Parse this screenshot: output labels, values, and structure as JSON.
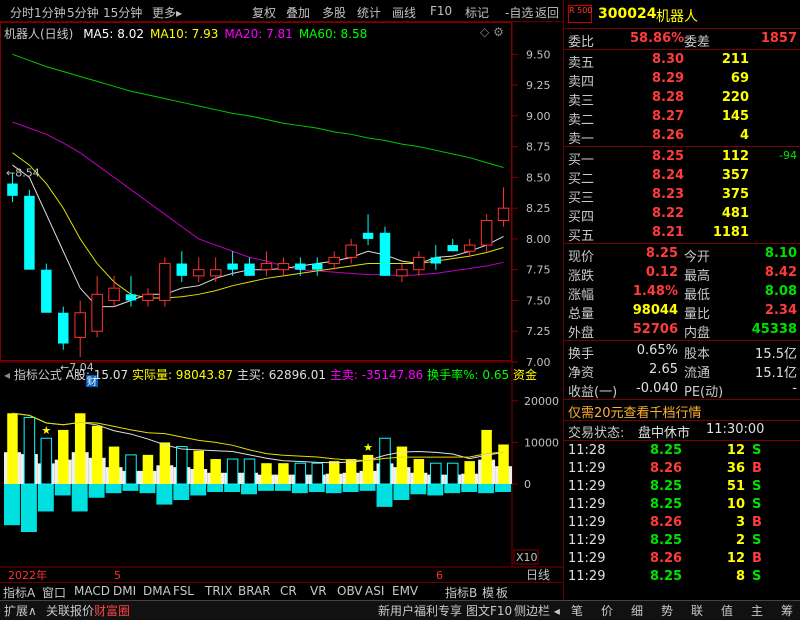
{
  "toolbar": {
    "items": [
      "分时",
      "1分钟",
      "5分钟",
      "15分钟",
      "更多▸",
      "复权",
      "叠加",
      "多股",
      "统计",
      "画线",
      "F10",
      "标记",
      "-自选",
      "返回"
    ]
  },
  "chart": {
    "title": "机器人(日线)",
    "ma_labels": [
      {
        "text": "MA5: 8.02",
        "color": "#ffffff"
      },
      {
        "text": "MA10: 7.93",
        "color": "#ffff00"
      },
      {
        "text": "MA20: 7.81",
        "color": "#ff00ff"
      },
      {
        "text": "MA60: 8.58",
        "color": "#00ff00"
      }
    ],
    "price_axis": [
      "9.50",
      "9.25",
      "9.00",
      "8.75",
      "8.50",
      "8.25",
      "8.00",
      "7.75",
      "7.50",
      "7.25",
      "7.00"
    ],
    "high_mark": "8.54",
    "low_mark": "7.04",
    "cai_mark": "财",
    "indicator_row": {
      "label": "指标公式",
      "a_shares": "A股: 15.07",
      "actual_vol": "实际量: 98043.87",
      "main_buy": "主买: 62896.01",
      "main_sell": "主卖: -35147.86",
      "turnover": "换手率%: 0.65",
      "fund": "资金"
    },
    "vol_axis": [
      "20000",
      "10000",
      "0"
    ],
    "x10": "X10",
    "date_labels": [
      "2022年",
      "5",
      "6"
    ],
    "period": "日线"
  },
  "chart_data": {
    "type": "candlestick",
    "ylim": [
      7.0,
      9.6
    ],
    "candles": [
      {
        "o": 8.45,
        "h": 8.54,
        "l": 8.3,
        "c": 8.35
      },
      {
        "o": 8.35,
        "h": 8.4,
        "l": 7.8,
        "c": 7.75
      },
      {
        "o": 7.75,
        "h": 7.8,
        "l": 7.5,
        "c": 7.4
      },
      {
        "o": 7.4,
        "h": 7.45,
        "l": 7.1,
        "c": 7.15
      },
      {
        "o": 7.2,
        "h": 7.5,
        "l": 7.04,
        "c": 7.4
      },
      {
        "o": 7.25,
        "h": 7.7,
        "l": 7.2,
        "c": 7.55
      },
      {
        "o": 7.5,
        "h": 7.7,
        "l": 7.45,
        "c": 7.6
      },
      {
        "o": 7.55,
        "h": 7.7,
        "l": 7.45,
        "c": 7.5
      },
      {
        "o": 7.5,
        "h": 7.6,
        "l": 7.45,
        "c": 7.55
      },
      {
        "o": 7.5,
        "h": 7.85,
        "l": 7.45,
        "c": 7.8
      },
      {
        "o": 7.8,
        "h": 7.9,
        "l": 7.65,
        "c": 7.7
      },
      {
        "o": 7.7,
        "h": 7.85,
        "l": 7.65,
        "c": 7.75
      },
      {
        "o": 7.7,
        "h": 7.85,
        "l": 7.65,
        "c": 7.75
      },
      {
        "o": 7.8,
        "h": 7.9,
        "l": 7.7,
        "c": 7.75
      },
      {
        "o": 7.8,
        "h": 7.85,
        "l": 7.7,
        "c": 7.7
      },
      {
        "o": 7.75,
        "h": 7.9,
        "l": 7.7,
        "c": 7.8
      },
      {
        "o": 7.75,
        "h": 7.85,
        "l": 7.7,
        "c": 7.8
      },
      {
        "o": 7.8,
        "h": 7.85,
        "l": 7.7,
        "c": 7.75
      },
      {
        "o": 7.8,
        "h": 7.85,
        "l": 7.7,
        "c": 7.75
      },
      {
        "o": 7.8,
        "h": 7.9,
        "l": 7.75,
        "c": 7.85
      },
      {
        "o": 7.85,
        "h": 8.0,
        "l": 7.8,
        "c": 7.95
      },
      {
        "o": 8.05,
        "h": 8.2,
        "l": 7.95,
        "c": 8.0
      },
      {
        "o": 8.05,
        "h": 8.1,
        "l": 7.7,
        "c": 7.7
      },
      {
        "o": 7.7,
        "h": 7.8,
        "l": 7.65,
        "c": 7.75
      },
      {
        "o": 7.75,
        "h": 7.9,
        "l": 7.7,
        "c": 7.85
      },
      {
        "o": 7.85,
        "h": 7.95,
        "l": 7.75,
        "c": 7.8
      },
      {
        "o": 7.95,
        "h": 8.0,
        "l": 7.9,
        "c": 7.9
      },
      {
        "o": 7.9,
        "h": 8.0,
        "l": 7.85,
        "c": 7.95
      },
      {
        "o": 7.95,
        "h": 8.2,
        "l": 7.9,
        "c": 8.15
      },
      {
        "o": 8.15,
        "h": 8.42,
        "l": 8.1,
        "c": 8.25
      }
    ],
    "ma5": [
      8.6,
      8.5,
      8.2,
      7.9,
      7.6,
      7.45,
      7.45,
      7.5,
      7.55,
      7.55,
      7.6,
      7.62,
      7.68,
      7.72,
      7.75,
      7.75,
      7.76,
      7.78,
      7.8,
      7.82,
      7.85,
      7.9,
      7.87,
      7.82,
      7.8,
      7.85,
      7.86,
      7.9,
      7.95,
      8.02
    ],
    "ma10": [
      8.7,
      8.6,
      8.45,
      8.25,
      8.0,
      7.8,
      7.65,
      7.55,
      7.52,
      7.52,
      7.53,
      7.55,
      7.58,
      7.62,
      7.65,
      7.68,
      7.7,
      7.72,
      7.74,
      7.76,
      7.78,
      7.8,
      7.8,
      7.8,
      7.8,
      7.82,
      7.84,
      7.86,
      7.89,
      7.93
    ],
    "ma20": [
      8.95,
      8.9,
      8.85,
      8.78,
      8.7,
      8.6,
      8.5,
      8.4,
      8.3,
      8.2,
      8.1,
      8.0,
      7.95,
      7.9,
      7.85,
      7.82,
      7.78,
      7.75,
      7.74,
      7.73,
      7.72,
      7.71,
      7.71,
      7.7,
      7.71,
      7.72,
      7.74,
      7.76,
      7.78,
      7.81
    ],
    "ma60": [
      9.5,
      9.45,
      9.4,
      9.36,
      9.32,
      9.28,
      9.24,
      9.2,
      9.17,
      9.14,
      9.11,
      9.08,
      9.05,
      9.02,
      9.0,
      8.97,
      8.94,
      8.92,
      8.9,
      8.87,
      8.85,
      8.82,
      8.8,
      8.77,
      8.75,
      8.72,
      8.69,
      8.66,
      8.62,
      8.58
    ],
    "volume_ylim": [
      0,
      25000
    ],
    "volume": [
      17000,
      16000,
      11000,
      13000,
      17000,
      14000,
      9000,
      7000,
      7000,
      10000,
      9000,
      8000,
      6000,
      6000,
      6000,
      5000,
      5000,
      5000,
      5000,
      5500,
      6000,
      7000,
      11000,
      9000,
      6000,
      5000,
      5000,
      5500,
      13000,
      9500
    ],
    "volume_red": [
      true,
      false,
      false,
      true,
      true,
      true,
      true,
      false,
      true,
      true,
      false,
      true,
      true,
      false,
      false,
      true,
      true,
      false,
      false,
      true,
      true,
      true,
      false,
      true,
      true,
      false,
      false,
      true,
      true,
      true
    ],
    "fund_flow": [
      -18000,
      -21000,
      -12000,
      -5000,
      -12000,
      -6000,
      -4000,
      -3000,
      -4000,
      -9000,
      -7000,
      -5000,
      -3500,
      -3500,
      -4500,
      -3000,
      -3000,
      -4000,
      -3500,
      -4000,
      -3500,
      -3000,
      -10000,
      -7000,
      -4500,
      -5000,
      -4000,
      -3500,
      -4000,
      -3500
    ],
    "star_index": [
      2,
      21
    ]
  },
  "quote": {
    "logo": "R 500",
    "code": "300024",
    "name": "机器人",
    "webi_label": "委比",
    "webi_val": "58.86%",
    "wecha_label": "委差",
    "wecha_val": "1857",
    "sells": [
      {
        "label": "卖五",
        "price": "8.30",
        "vol": "211",
        "chg": ""
      },
      {
        "label": "卖四",
        "price": "8.29",
        "vol": "69",
        "chg": ""
      },
      {
        "label": "卖三",
        "price": "8.28",
        "vol": "220",
        "chg": ""
      },
      {
        "label": "卖二",
        "price": "8.27",
        "vol": "145",
        "chg": ""
      },
      {
        "label": "卖一",
        "price": "8.26",
        "vol": "4",
        "chg": ""
      }
    ],
    "buys": [
      {
        "label": "买一",
        "price": "8.25",
        "vol": "112",
        "chg": "-94"
      },
      {
        "label": "买二",
        "price": "8.24",
        "vol": "357",
        "chg": ""
      },
      {
        "label": "买三",
        "price": "8.23",
        "vol": "375",
        "chg": ""
      },
      {
        "label": "买四",
        "price": "8.22",
        "vol": "481",
        "chg": ""
      },
      {
        "label": "买五",
        "price": "8.21",
        "vol": "1181",
        "chg": ""
      }
    ],
    "stats": [
      {
        "l1": "现价",
        "v1": "8.25",
        "c1": "red",
        "l2": "今开",
        "v2": "8.10",
        "c2": "grn"
      },
      {
        "l1": "涨跌",
        "v1": "0.12",
        "c1": "red",
        "l2": "最高",
        "v2": "8.42",
        "c2": "red"
      },
      {
        "l1": "涨幅",
        "v1": "1.48%",
        "c1": "red",
        "l2": "最低",
        "v2": "8.08",
        "c2": "grn"
      },
      {
        "l1": "总量",
        "v1": "98044",
        "c1": "yel",
        "l2": "量比",
        "v2": "2.34",
        "c2": "red"
      },
      {
        "l1": "外盘",
        "v1": "52706",
        "c1": "red",
        "l2": "内盘",
        "v2": "45338",
        "c2": "grn"
      }
    ],
    "stats2": [
      {
        "l1": "换手",
        "v1": "0.65%",
        "l2": "股本",
        "v2": "15.5亿"
      },
      {
        "l1": "净资",
        "v1": "2.65",
        "l2": "流通",
        "v2": "15.1亿"
      },
      {
        "l1": "收益(一)",
        "v1": "-0.040",
        "l2": "PE(动)",
        "v2": "-"
      }
    ],
    "promo": "仅需20元查看千档行情",
    "status_label": "交易状态:",
    "status_text": "盘中休市",
    "status_time": "11:30:00",
    "ticks": [
      {
        "t": "11:28",
        "p": "8.25",
        "v": "12",
        "s": "S"
      },
      {
        "t": "11:29",
        "p": "8.26",
        "v": "36",
        "s": "B"
      },
      {
        "t": "11:29",
        "p": "8.25",
        "v": "51",
        "s": "S"
      },
      {
        "t": "11:29",
        "p": "8.25",
        "v": "10",
        "s": "S"
      },
      {
        "t": "11:29",
        "p": "8.26",
        "v": "3",
        "s": "B"
      },
      {
        "t": "11:29",
        "p": "8.25",
        "v": "2",
        "s": "S"
      },
      {
        "t": "11:29",
        "p": "8.26",
        "v": "12",
        "s": "B"
      },
      {
        "t": "11:29",
        "p": "8.25",
        "v": "8",
        "s": "S"
      }
    ]
  },
  "indicator_tabs": [
    "指标A",
    "窗口",
    "MACD",
    "DMI",
    "DMA",
    "FSL",
    "TRIX",
    "BRAR",
    "CR",
    "VR",
    "OBV",
    "ASI",
    "EMV"
  ],
  "indicator_tabs_right": [
    "指标B",
    "模",
    "板"
  ],
  "bottom_tabs": [
    "扩展∧",
    "关联报价",
    "财富圈"
  ],
  "bottom_right": [
    "新用户福利专享",
    "图文F10",
    "侧边栏 ◂"
  ],
  "side_tabs": [
    "笔",
    "价",
    "细",
    "势",
    "联",
    "值",
    "主",
    "筹"
  ]
}
